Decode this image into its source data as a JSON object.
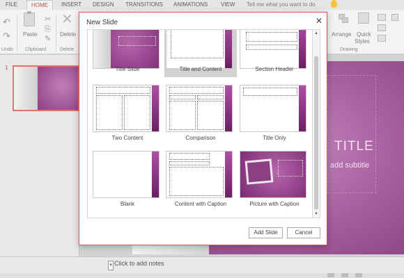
{
  "ribbon": {
    "tabs": [
      "FILE",
      "HOME",
      "INSERT",
      "DESIGN",
      "TRANSITIONS",
      "ANIMATIONS",
      "VIEW"
    ],
    "active_tab": "HOME",
    "tell_me": "Tell me what you want to do",
    "buttons": {
      "paste": "Paste",
      "delete": "Delete",
      "arrange": "Arrange",
      "quick_styles_1": "Quick",
      "quick_styles_2": "Styles"
    },
    "groups": {
      "undo": "Undo",
      "clipboard": "Clipboard",
      "slides": "Delete",
      "drawing": "Drawing"
    }
  },
  "thumbnails": {
    "slide_number": "1"
  },
  "slide": {
    "title": "TITLE",
    "subtitle": "add subtitle"
  },
  "notes": {
    "placeholder": "Click to add notes"
  },
  "dialog": {
    "title": "New Slide",
    "close_glyph": "✕",
    "layouts": [
      "Title Slide",
      "Title and Content",
      "Section Header",
      "Two Content",
      "Comparison",
      "Title Only",
      "Blank",
      "Content with Caption",
      "Picture with Caption"
    ],
    "selected_layout": "Title and Content",
    "add_button": "Add Slide",
    "cancel_button": "Cancel"
  },
  "colors": {
    "accent": "#c0504d",
    "dialog_border": "#d9534f",
    "theme_purple": "#9b4c92"
  }
}
